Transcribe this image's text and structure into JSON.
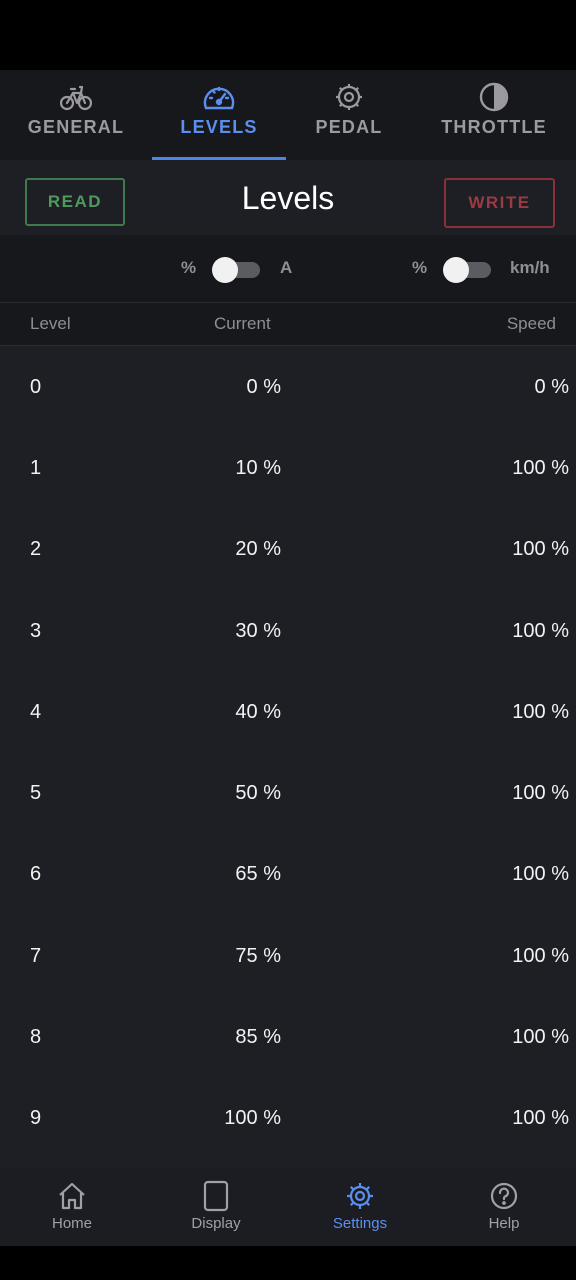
{
  "tabs": [
    {
      "label": "GENERAL",
      "icon": "bicycle-icon"
    },
    {
      "label": "LEVELS",
      "icon": "speedometer-icon"
    },
    {
      "label": "PEDAL",
      "icon": "gear-icon"
    },
    {
      "label": "THROTTLE",
      "icon": "half-circle-icon"
    }
  ],
  "active_tab": "LEVELS",
  "header": {
    "read_label": "READ",
    "title": "Levels",
    "write_label": "WRITE"
  },
  "units": {
    "current_left": "%",
    "current_right": "A",
    "speed_left": "%",
    "speed_right": "km/h"
  },
  "table": {
    "columns": [
      "Level",
      "Current",
      "Speed"
    ],
    "rows": [
      [
        "0",
        "0 %",
        "0 %"
      ],
      [
        "1",
        "10 %",
        "100 %"
      ],
      [
        "2",
        "20 %",
        "100 %"
      ],
      [
        "3",
        "30 %",
        "100 %"
      ],
      [
        "4",
        "40 %",
        "100 %"
      ],
      [
        "5",
        "50 %",
        "100 %"
      ],
      [
        "6",
        "65 %",
        "100 %"
      ],
      [
        "7",
        "75 %",
        "100 %"
      ],
      [
        "8",
        "85 %",
        "100 %"
      ],
      [
        "9",
        "100 %",
        "100 %"
      ]
    ]
  },
  "bottom_nav": [
    {
      "label": "Home",
      "icon": "home-icon"
    },
    {
      "label": "Display",
      "icon": "display-icon"
    },
    {
      "label": "Settings",
      "icon": "settings-icon"
    },
    {
      "label": "Help",
      "icon": "help-icon"
    }
  ],
  "active_nav": "Settings",
  "colors": {
    "accent": "#5a8ff0",
    "read": "#4e9a5e",
    "write": "#9c3a44",
    "background": "#1d1f25"
  }
}
